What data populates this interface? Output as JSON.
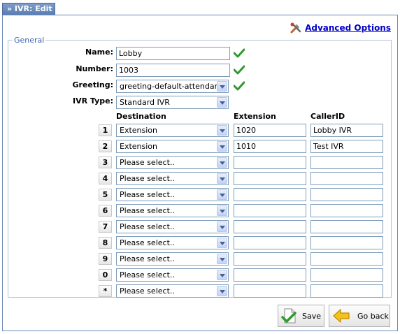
{
  "tab": {
    "title": "» IVR: Edit"
  },
  "advanced": {
    "label": "Advanced Options"
  },
  "general": {
    "legend": "General",
    "name_label": "Name:",
    "name_value": "Lobby",
    "number_label": "Number:",
    "number_value": "1003",
    "greeting_label": "Greeting:",
    "greeting_value": "greeting-default-attendant",
    "ivr_type_label": "IVR Type:",
    "ivr_type_value": "Standard IVR"
  },
  "columns": {
    "destination": "Destination",
    "extension": "Extension",
    "callerid": "CallerID"
  },
  "rows": [
    {
      "key": "1",
      "destination": "Extension",
      "extension": "1020",
      "callerid": "Lobby IVR"
    },
    {
      "key": "2",
      "destination": "Extension",
      "extension": "1010",
      "callerid": "Test IVR"
    },
    {
      "key": "3",
      "destination": "Please select..",
      "extension": "",
      "callerid": ""
    },
    {
      "key": "4",
      "destination": "Please select..",
      "extension": "",
      "callerid": ""
    },
    {
      "key": "5",
      "destination": "Please select..",
      "extension": "",
      "callerid": ""
    },
    {
      "key": "6",
      "destination": "Please select..",
      "extension": "",
      "callerid": ""
    },
    {
      "key": "7",
      "destination": "Please select..",
      "extension": "",
      "callerid": ""
    },
    {
      "key": "8",
      "destination": "Please select..",
      "extension": "",
      "callerid": ""
    },
    {
      "key": "9",
      "destination": "Please select..",
      "extension": "",
      "callerid": ""
    },
    {
      "key": "0",
      "destination": "Please select..",
      "extension": "",
      "callerid": ""
    },
    {
      "key": "*",
      "destination": "Please select..",
      "extension": "",
      "callerid": ""
    }
  ],
  "buttons": {
    "save": "Save",
    "go_back": "Go back"
  },
  "colors": {
    "accent": "#3b64b4",
    "link": "#0000cc",
    "check": "#2f9a2f"
  }
}
